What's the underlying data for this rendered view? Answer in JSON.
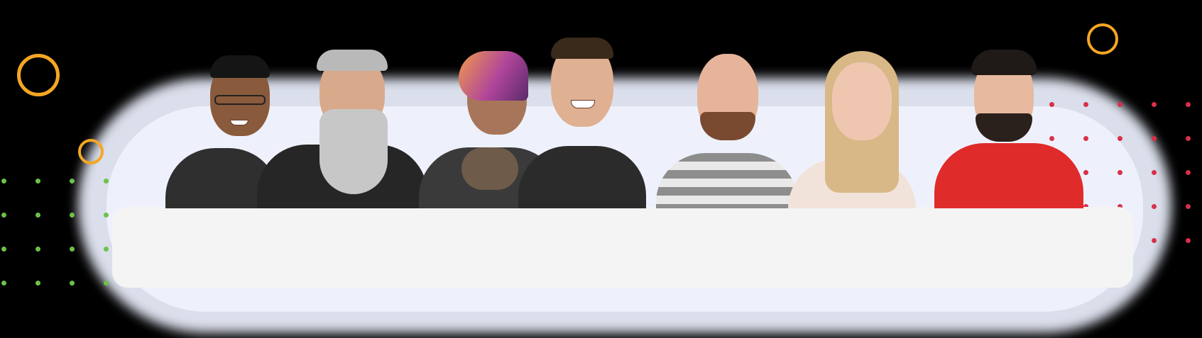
{
  "scene": {
    "description_type": "team-photo-banner",
    "people_count": 7
  },
  "colors": {
    "background": "#000000",
    "panel": "#f4f4f4",
    "glow": "#e6ebf8",
    "ring_accent": "#f5a623",
    "green_dots": "#6cc24a",
    "red_dots": "#d9304a"
  },
  "people": [
    {
      "shirt": "#2f2f2f",
      "skin": "#8a5a3c",
      "hair": "#151515",
      "name_tag": "person-1"
    },
    {
      "shirt": "#262626",
      "skin": "#d9a98c",
      "hair": "#b9b9b9",
      "name_tag": "person-2"
    },
    {
      "shirt": "#3a3a3a",
      "skin": "#a7765a",
      "hair": "#b0459b",
      "name_tag": "person-3"
    },
    {
      "shirt": "#2b2b2b",
      "skin": "#e0b092",
      "hair": "#3a2a1c",
      "name_tag": "person-4"
    },
    {
      "shirt": "striped-gray",
      "skin": "#e6b49a",
      "hair": "#d8b8a5",
      "name_tag": "person-5"
    },
    {
      "shirt": "#f2e3da",
      "skin": "#efc7b1",
      "hair": "#d9b887",
      "name_tag": "person-6"
    },
    {
      "shirt": "#e02b2b",
      "skin": "#e7b99f",
      "hair": "#1f1a18",
      "name_tag": "person-7"
    }
  ]
}
